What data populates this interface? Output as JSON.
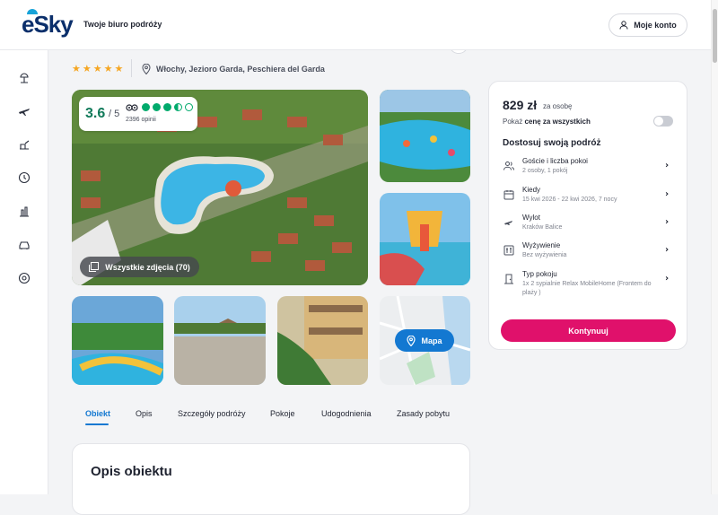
{
  "header": {
    "brand": "eSky",
    "tagline": "Twoje biuro podróży",
    "account_label": "Moje konto"
  },
  "sidebar": {
    "items": [
      {
        "icon": "beach-umbrella-icon"
      },
      {
        "icon": "plane-icon"
      },
      {
        "icon": "plane-hotel-icon"
      },
      {
        "icon": "clock-icon"
      },
      {
        "icon": "city-break-icon"
      },
      {
        "icon": "car-icon"
      },
      {
        "icon": "support-icon"
      }
    ]
  },
  "hotel": {
    "stars": "★★★★★",
    "location": "Włochy, Jezioro Garda, Peschiera del Garda"
  },
  "rating": {
    "score": "3.6",
    "out_of": "/ 5",
    "count": "2396 opinii",
    "circles_filled": 3.5,
    "circles_total": 5
  },
  "gallery": {
    "all_photos_label": "Wszystkie zdjęcia (70)",
    "map_label": "Mapa"
  },
  "tabs": [
    {
      "label": "Obiekt",
      "active": true
    },
    {
      "label": "Opis",
      "active": false
    },
    {
      "label": "Szczegóły podróży",
      "active": false
    },
    {
      "label": "Pokoje",
      "active": false
    },
    {
      "label": "Udogodnienia",
      "active": false
    },
    {
      "label": "Zasady pobytu",
      "active": false
    }
  ],
  "description": {
    "title": "Opis obiektu"
  },
  "booking": {
    "price": "829 zł",
    "price_unit": "za osobę",
    "show_all_prefix": "Pokaż ",
    "show_all_bold": "cenę za wszystkich",
    "adjust_title": "Dostosuj swoją podróż",
    "options": [
      {
        "title": "Goście i liczba pokoi",
        "sub": "2 osoby, 1 pokój",
        "icon": "guests-icon"
      },
      {
        "title": "Kiedy",
        "sub": "15 kwi 2026 - 22 kwi 2026, 7 nocy",
        "icon": "calendar-icon"
      },
      {
        "title": "Wylot",
        "sub": "Kraków Balice",
        "icon": "plane-departure-icon"
      },
      {
        "title": "Wyżywienie",
        "sub": "Bez wyżywienia",
        "icon": "food-icon"
      },
      {
        "title": "Typ pokoju",
        "sub": "1x 2 sypialnie Relax MobileHome (Frontem do plaży )",
        "icon": "door-icon"
      }
    ],
    "continue_label": "Kontynuuj"
  },
  "colors": {
    "accent_blue": "#1378d1",
    "continue_pink": "#e0116b",
    "tripadvisor_green": "#00aa6c",
    "star_orange": "#f5a623"
  }
}
